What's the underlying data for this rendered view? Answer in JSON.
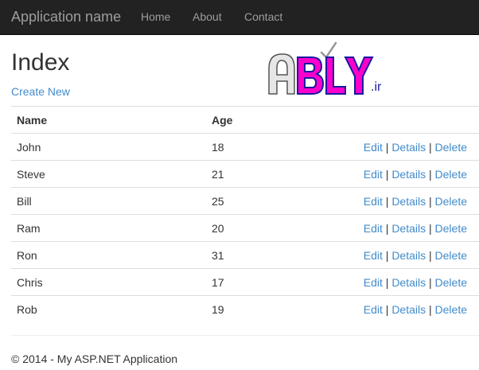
{
  "navbar": {
    "brand": "Application name",
    "items": [
      {
        "label": "Home"
      },
      {
        "label": "About"
      },
      {
        "label": "Contact"
      }
    ]
  },
  "page": {
    "title": "Index",
    "create_link": "Create New"
  },
  "logo": {
    "text": "ABLY",
    "suffix": ".ir",
    "colors": {
      "a": "#e0e0e0",
      "bly": "#ff00cc",
      "outline": "#1a1aa0",
      "suffix": "#1a1aa0"
    }
  },
  "table": {
    "headers": {
      "name": "Name",
      "age": "Age"
    },
    "actions": {
      "edit": "Edit",
      "details": "Details",
      "delete": "Delete",
      "separator": "|"
    },
    "rows": [
      {
        "name": "John",
        "age": "18"
      },
      {
        "name": "Steve",
        "age": "21"
      },
      {
        "name": "Bill",
        "age": "25"
      },
      {
        "name": "Ram",
        "age": "20"
      },
      {
        "name": "Ron",
        "age": "31"
      },
      {
        "name": "Chris",
        "age": "17"
      },
      {
        "name": "Rob",
        "age": "19"
      }
    ]
  },
  "footer": {
    "text": "© 2014 - My ASP.NET Application"
  },
  "colors": {
    "navbar_bg": "#222222",
    "nav_text": "#9d9d9d",
    "link": "#428bca",
    "text": "#333333",
    "border": "#dddddd"
  }
}
